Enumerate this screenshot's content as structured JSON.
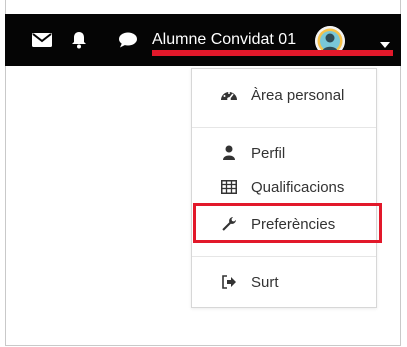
{
  "header": {
    "user_name": "Alumne Convidat 01",
    "icons": [
      "mail-icon",
      "bell-icon",
      "chat-icon",
      "avatar",
      "caret-down-icon"
    ]
  },
  "user_menu": {
    "items": [
      {
        "label": "Àrea personal",
        "icon": "dashboard-icon"
      },
      {
        "label": "Perfil",
        "icon": "user-icon"
      },
      {
        "label": "Qualificacions",
        "icon": "table-icon"
      },
      {
        "label": "Preferències",
        "icon": "wrench-icon"
      },
      {
        "label": "Surt",
        "icon": "sign-out-icon"
      }
    ]
  },
  "colors": {
    "topbar": "#050505",
    "highlight": "#e2182a",
    "menu_text": "#333333"
  }
}
